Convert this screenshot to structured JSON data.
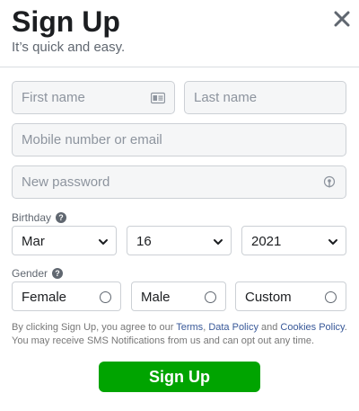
{
  "header": {
    "title": "Sign Up",
    "subtitle": "It’s quick and easy."
  },
  "form": {
    "first_name": {
      "placeholder": "First name",
      "value": ""
    },
    "last_name": {
      "placeholder": "Last name",
      "value": ""
    },
    "contact": {
      "placeholder": "Mobile number or email",
      "value": ""
    },
    "password": {
      "placeholder": "New password",
      "value": ""
    }
  },
  "birthday": {
    "label": "Birthday",
    "month": "Mar",
    "day": "16",
    "year": "2021"
  },
  "gender": {
    "label": "Gender",
    "options": [
      "Female",
      "Male",
      "Custom"
    ]
  },
  "terms": {
    "prefix": "By clicking Sign Up, you agree to our ",
    "terms_link": "Terms",
    "sep1": ", ",
    "data_policy_link": "Data Policy",
    "sep2": " and ",
    "cookies_link": "Cookies Policy",
    "suffix": ". You may receive SMS Notifications from us and can opt out any time."
  },
  "actions": {
    "signup_label": "Sign Up"
  },
  "icons": {
    "close": "close-icon",
    "contact_card": "contact-card-icon",
    "password_key": "password-key-icon",
    "help": "help-icon",
    "chevron": "chevron-down-icon"
  },
  "colors": {
    "primary_button": "#00a400",
    "link": "#385898",
    "field_bg": "#f5f6f7",
    "border": "#ccd0d5"
  }
}
